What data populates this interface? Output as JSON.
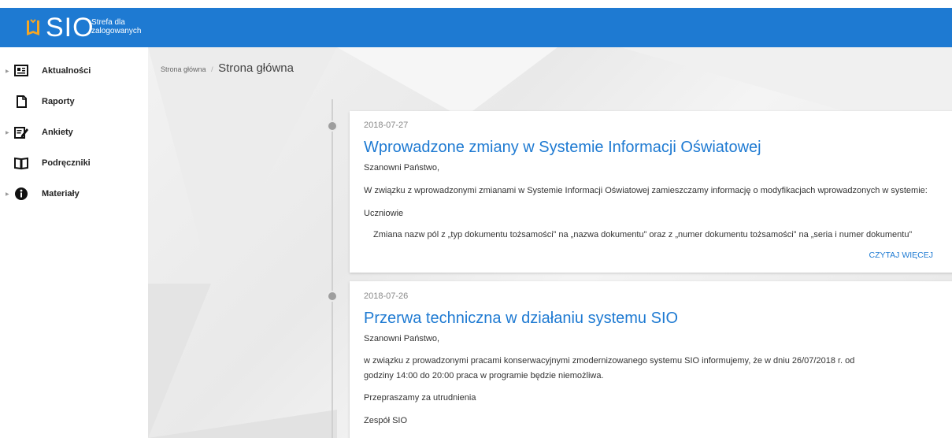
{
  "header": {
    "logo_text": "SIO",
    "logo_sub_line1": "Strefa dla",
    "logo_sub_line2": "zalogowanych",
    "brand_color": "#1e7ad2"
  },
  "sidebar": {
    "items": [
      {
        "label": "Aktualności",
        "icon": "newspaper-icon",
        "has_caret": true
      },
      {
        "label": "Raporty",
        "icon": "document-icon",
        "has_caret": false
      },
      {
        "label": "Ankiety",
        "icon": "edit-form-icon",
        "has_caret": true
      },
      {
        "label": "Podręczniki",
        "icon": "open-book-icon",
        "has_caret": false
      },
      {
        "label": "Materiały",
        "icon": "info-icon",
        "has_caret": true
      }
    ]
  },
  "breadcrumb": {
    "home": "Strona główna",
    "separator": "/",
    "current": "Strona główna"
  },
  "news": [
    {
      "date": "2018-07-27",
      "title": "Wprowadzone zmiany w Systemie Informacji Oświatowej",
      "greeting": "Szanowni Państwo,",
      "para1": "W związku z wprowadzonymi zmianami w Systemie Informacji Oświatowej zamieszczamy informację o modyfikacjach wprowadzonych w systemie:",
      "section": "Uczniowie",
      "item": "Zmiana nazw pól z „typ dokumentu tożsamości” na „nazwa dokumentu” oraz z „numer dokumentu tożsamości” na „seria i numer dokumentu”",
      "read_more": "CZYTAJ WIĘCEJ"
    },
    {
      "date": "2018-07-26",
      "title": "Przerwa techniczna w działaniu systemu SIO",
      "greeting": "Szanowni Państwo,",
      "para1": "w związku z prowadzonymi pracami konserwacyjnymi zmodernizowanego systemu SIO informujemy, że w dniu 26/07/2018 r. od",
      "para1b": "godziny 14:00 do 20:00 praca w programie będzie niemożliwa.",
      "para2": "Przepraszamy za utrudnienia",
      "signature": "Zespół SIO"
    }
  ]
}
